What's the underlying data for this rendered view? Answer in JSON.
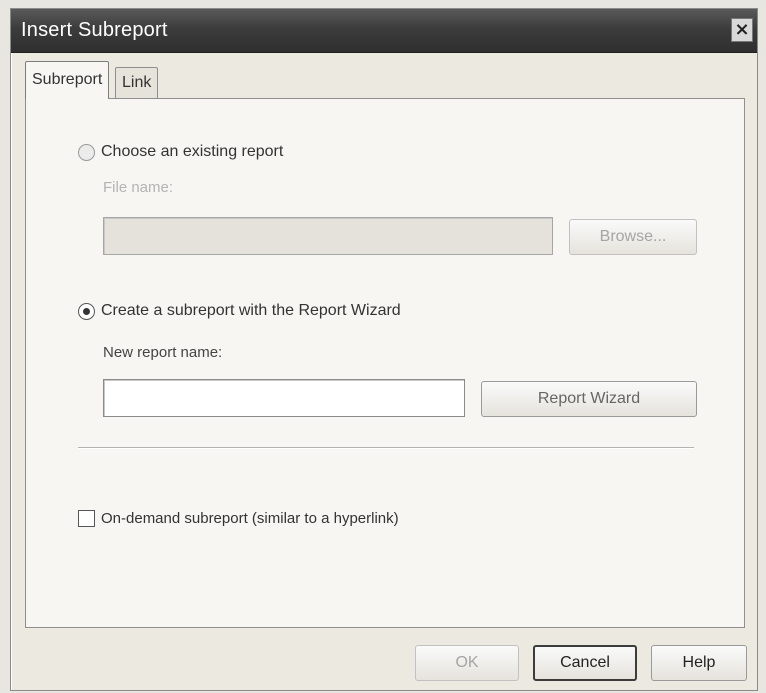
{
  "window": {
    "title": "Insert Subreport",
    "close_glyph": "×"
  },
  "tabs": [
    {
      "label": "Subreport",
      "active": true
    },
    {
      "label": "Link",
      "active": false
    }
  ],
  "existing": {
    "radio_label": "Choose an existing report",
    "selected": false,
    "file_name_label": "File name:",
    "file_name_value": "",
    "browse_label": "Browse..."
  },
  "wizard": {
    "radio_label": "Create a subreport with the Report Wizard",
    "selected": true,
    "name_label": "New report name:",
    "name_value": "",
    "wizard_button_label": "Report Wizard"
  },
  "on_demand": {
    "label": "On-demand subreport (similar to a hyperlink)",
    "checked": false
  },
  "footer": {
    "ok_label": "OK",
    "cancel_label": "Cancel",
    "help_label": "Help"
  }
}
